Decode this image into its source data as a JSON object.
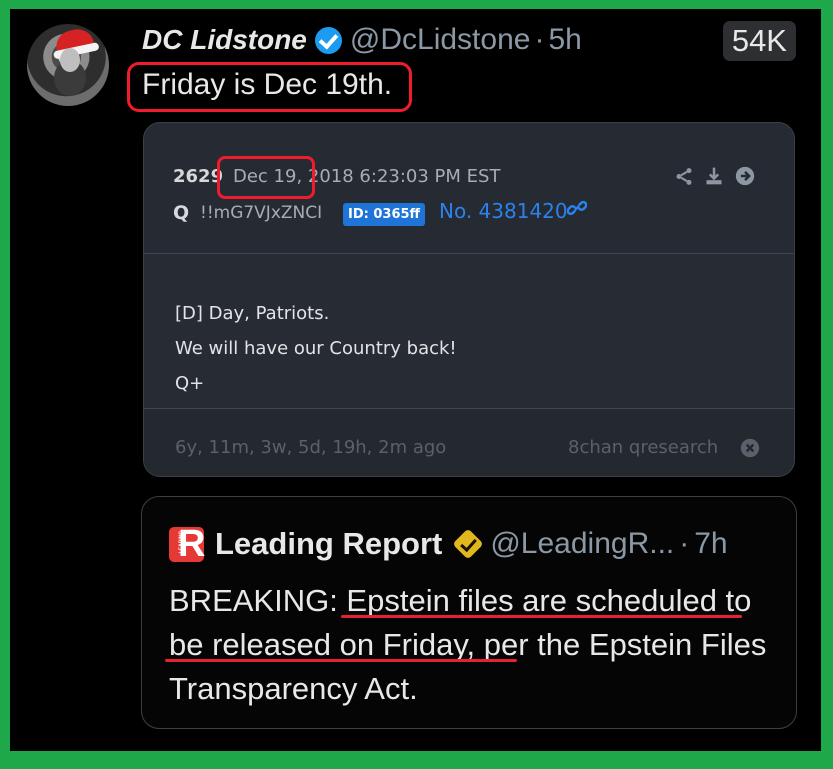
{
  "tweet": {
    "display_name": "DC Lidstone",
    "handle": "@DcLidstone",
    "separator": "·",
    "age": "5h",
    "views": "54K",
    "text": "Friday is Dec 19th."
  },
  "qpost": {
    "number": "2629",
    "date": "Dec 19, 2018 6:23:03 PM EST",
    "name": "Q",
    "tripcode": "!!mG7VJxZNCI",
    "id_badge": "ID: 0365ff",
    "post_number": "No. 4381420",
    "message_lines": [
      "[D] Day, Patriots.",
      "We will have our Country back!",
      "Q+"
    ],
    "age": "6y, 11m, 3w, 5d, 19h, 2m ago",
    "source": "8chan qresearch"
  },
  "quote": {
    "display_name": "Leading Report",
    "handle": "@LeadingR...",
    "separator": "·",
    "age": "7h",
    "text": "BREAKING: Epstein files are scheduled to be released on Friday, per the Epstein Files Transparency Act.",
    "logo_letter": "R",
    "logo_small_text": "LEADING"
  },
  "colors": {
    "background_border": "#1fa84a",
    "annotation_red": "#ef1d2b",
    "verified_blue": "#1d9bf0",
    "qpost_link_blue": "#2a82ef",
    "gold_badge": "#e2b71d",
    "leading_report_red": "#e53935"
  },
  "icons": [
    "share-icon",
    "download-icon",
    "arrow-right-circle-icon",
    "link-icon",
    "close-icon",
    "verified-badge-icon",
    "gold-verified-badge-icon"
  ]
}
